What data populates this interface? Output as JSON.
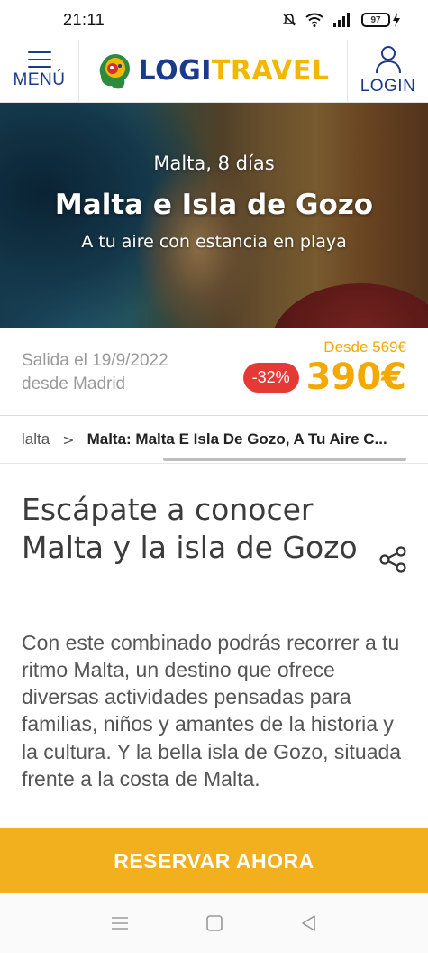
{
  "status_bar": {
    "time": "21:11",
    "battery": "97"
  },
  "header": {
    "menu_label": "MENÚ",
    "logo_part1": "LOGI",
    "logo_part2": "TRAVEL",
    "login_label": "LOGIN"
  },
  "hero": {
    "subtitle": "Malta, 8 días",
    "title": "Malta e Isla de Gozo",
    "tagline": "A tu aire con estancia en playa"
  },
  "price": {
    "departure_line1": "Salida el 19/9/2022",
    "departure_line2": "desde Madrid",
    "from_label": "Desde",
    "old_price": "569€",
    "discount": "-32%",
    "current_price": "390€"
  },
  "breadcrumb": {
    "prev": "lalta",
    "current": "Malta: Malta E Isla De Gozo, A Tu Aire C..."
  },
  "article": {
    "title": "Escápate a conocer Malta y la isla de Gozo",
    "body": "Con este combinado podrás recorrer a tu ritmo Malta, un destino que ofrece diversas actividades pensadas para familias, niños y amantes de la historia y la cultura. Y la bella isla de Gozo, situada frente a la costa de Malta."
  },
  "cta": {
    "label": "RESERVAR AHORA"
  },
  "colors": {
    "brand_blue": "#1b3a8a",
    "brand_yellow": "#f2b700",
    "cta": "#f2b01e",
    "discount_red": "#e53935"
  },
  "icons": [
    "mute-icon",
    "wifi-icon",
    "signal-icon",
    "battery-icon",
    "charging-icon",
    "menu-icon",
    "logo-icon",
    "user-icon",
    "share-icon",
    "recents-icon",
    "home-icon",
    "back-icon"
  ]
}
